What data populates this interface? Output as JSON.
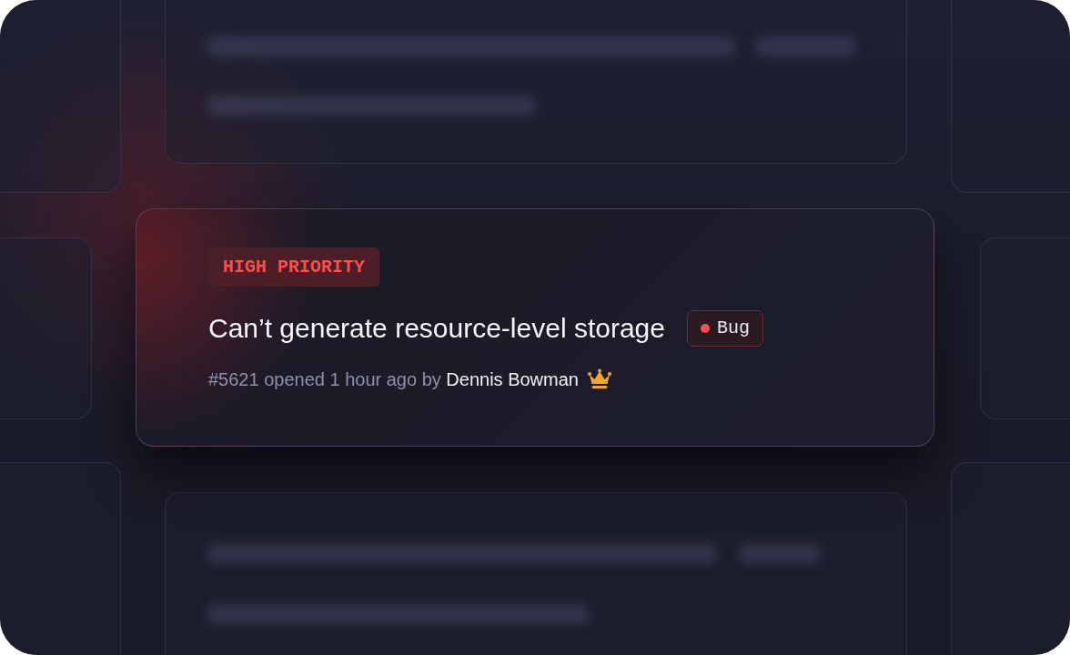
{
  "card": {
    "priority": "HIGH PRIORITY",
    "title": "Can’t generate resource-level storage",
    "tag": {
      "label": "Bug",
      "color": "#ff4d4d"
    },
    "meta": {
      "prefix": "#5621 opened 1 hour ago by",
      "author": "Dennis Bowman"
    }
  }
}
